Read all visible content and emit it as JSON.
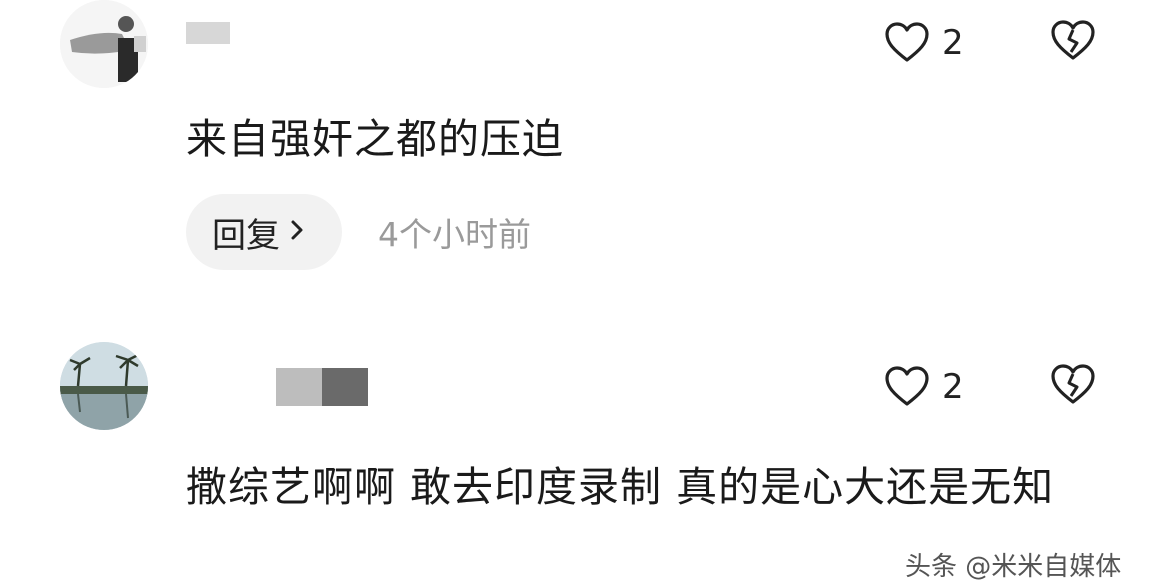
{
  "comments": [
    {
      "like_count": "2",
      "text": "来自强奸之都的压迫",
      "reply_label": "回复",
      "time": "4个小时前"
    },
    {
      "like_count": "2",
      "text": "撒综艺啊啊 敢去印度录制 真的是心大还是无知"
    }
  ],
  "watermark": "头条 @米米自媒体",
  "icons": [
    "heart-outline-icon",
    "broken-heart-icon",
    "chevron-right-icon"
  ]
}
